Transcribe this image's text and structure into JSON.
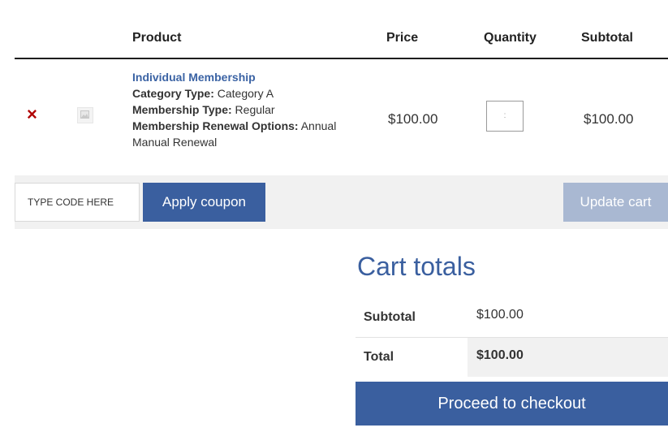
{
  "table": {
    "headers": {
      "product": "Product",
      "price": "Price",
      "quantity": "Quantity",
      "subtotal": "Subtotal"
    },
    "item": {
      "remove_icon": "×",
      "thumbnail_icon": "image-placeholder-icon",
      "name": "Individual Membership",
      "meta": [
        {
          "label": "Category Type:",
          "value": "Category A"
        },
        {
          "label": "Membership Type:",
          "value": "Regular"
        },
        {
          "label": "Membership Renewal Options:",
          "value": "Annual Manual Renewal"
        }
      ],
      "price": "$100.00",
      "quantity_value": ":",
      "subtotal": "$100.00"
    }
  },
  "actions": {
    "coupon_placeholder": "TYPE CODE HERE",
    "apply_label": "Apply coupon",
    "update_label": "Update cart"
  },
  "totals": {
    "title": "Cart totals",
    "subtotal_label": "Subtotal",
    "subtotal_value": "$100.00",
    "total_label": "Total",
    "total_value": "$100.00",
    "checkout_label": "Proceed to checkout"
  },
  "colors": {
    "accent": "#3a5f9f",
    "link": "#3b63a4",
    "remove": "#b00000",
    "disabled_button": "#a9b8d2",
    "panel_bg": "#f1f1f1"
  }
}
